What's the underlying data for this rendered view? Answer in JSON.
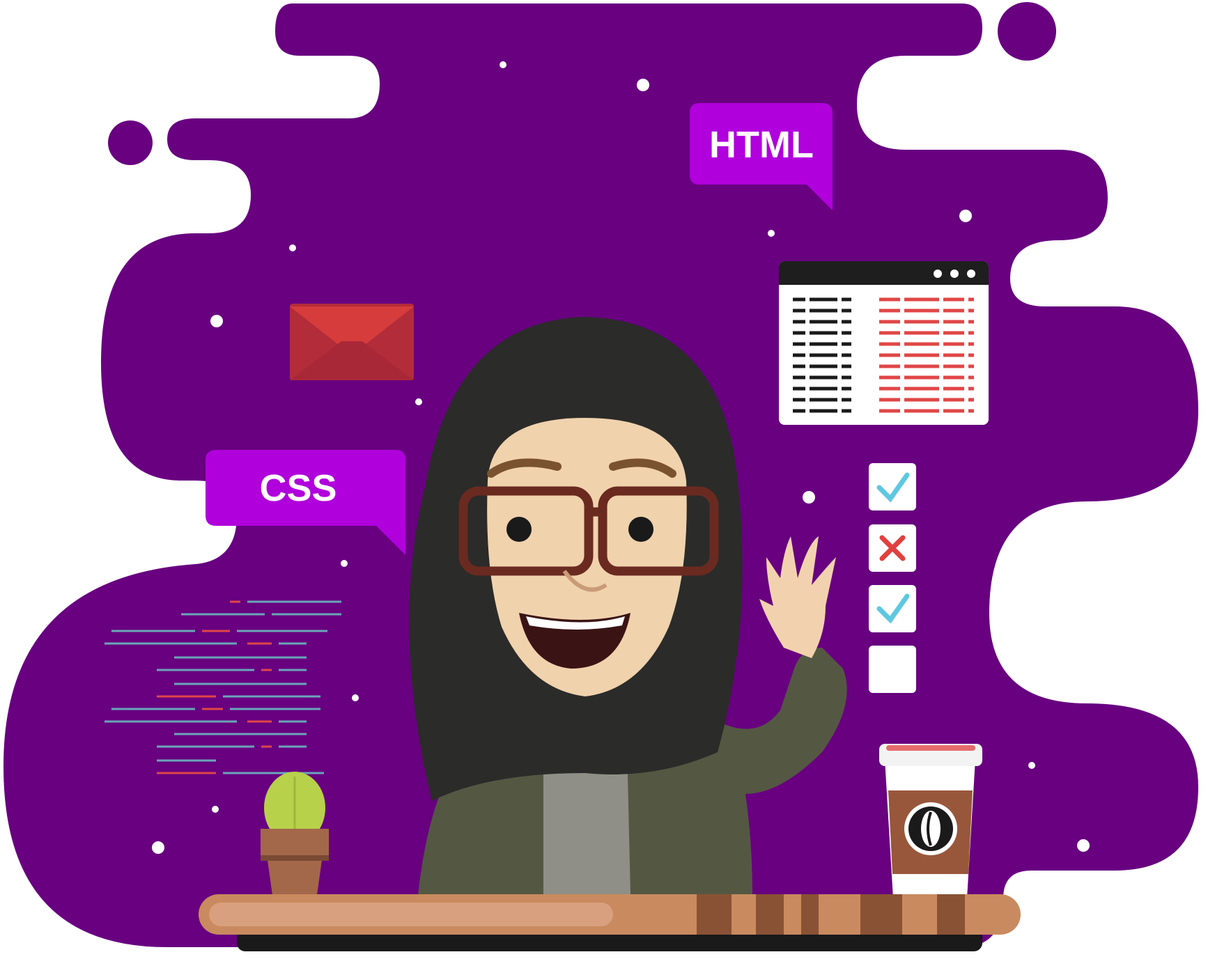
{
  "bubbles": {
    "html_label": "HTML",
    "css_label": "CSS"
  },
  "icons": {
    "mail": "envelope-icon",
    "browser": "browser-window-icon",
    "checklist": "checklist-icon",
    "coffee": "coffee-cup-icon",
    "plant": "cactus-icon"
  },
  "checklist": {
    "items": [
      "checked",
      "crossed",
      "checked",
      "empty"
    ]
  },
  "colors": {
    "background_blob": "#680080",
    "bubble": "#b000dc",
    "envelope": "#d63c3c",
    "desk": "#c98a5f",
    "check": "#5ec8e0",
    "cross": "#e0413f"
  }
}
